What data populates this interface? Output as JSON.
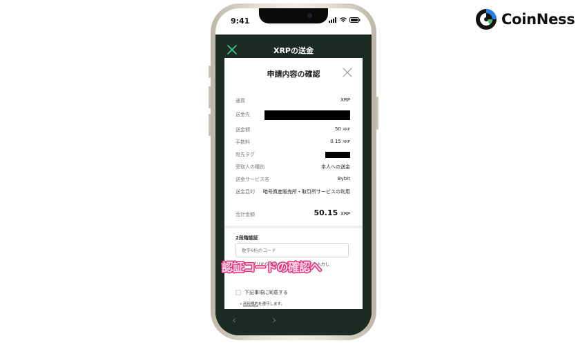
{
  "brand": {
    "name": "CoinNess"
  },
  "status_bar": {
    "time": "9:41"
  },
  "app": {
    "title": "XRPの送金"
  },
  "modal": {
    "title": "申請内容の確認",
    "rows": [
      {
        "label": "通貨",
        "value": "XRP",
        "unit": ""
      },
      {
        "label": "送金先",
        "value": "",
        "unit": ""
      },
      {
        "label": "送金額",
        "value": "50",
        "unit": "XRP"
      },
      {
        "label": "手数料",
        "value": "0.15",
        "unit": "XRP"
      },
      {
        "label": "宛先タグ",
        "value": "",
        "unit": ""
      },
      {
        "label": "受取人の種別",
        "value": "本人への送金",
        "unit": ""
      },
      {
        "label": "送金サービス名",
        "value": "Bybit",
        "unit": ""
      },
      {
        "label": "送金目的",
        "value": "暗号資産販売所・取引所サービスの利用",
        "unit": ""
      }
    ],
    "total": {
      "label": "合計金額",
      "value": "50.15",
      "unit": "XRP"
    },
    "two_factor": {
      "title": "2段階認証",
      "placeholder": "数字6桁のコード",
      "helper": "認証用アプリから生成された6桁のコードを入力し"
    },
    "agreement": {
      "label": "下記事項に同意する",
      "terms_link": "利用規約",
      "terms_suffix": "を遵守します。"
    }
  },
  "overlay": {
    "caption": "認証コードの確認へ"
  },
  "nav": {
    "back": "‹",
    "forward": "›"
  },
  "colors": {
    "app_dark": "#1c2a24",
    "accent_green": "#2ecc8f",
    "caption_pink": "#e0307a"
  }
}
